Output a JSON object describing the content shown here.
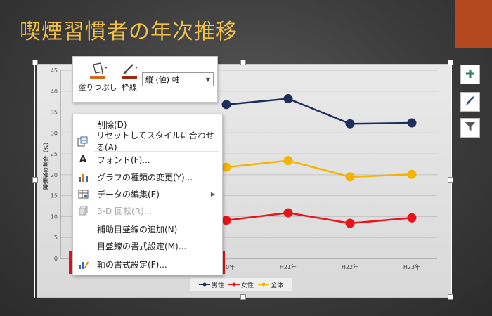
{
  "slide": {
    "title": "喫煙習慣者の年次推移"
  },
  "mini_toolbar": {
    "fill_label": "塗りつぶし",
    "outline_label": "枠線",
    "element_select_value": "縦 (値) 軸"
  },
  "context_menu": {
    "items": [
      {
        "label": "削除(D)",
        "icon": "delete-icon",
        "enabled": true
      },
      {
        "label": "リセットしてスタイルに合わせる(A)",
        "icon": "reset-style-icon",
        "enabled": true
      },
      {
        "label": "フォント(F)...",
        "icon": "font-icon",
        "enabled": true
      },
      {
        "label": "グラフの種類の変更(Y)...",
        "icon": "chart-type-icon",
        "enabled": true
      },
      {
        "label": "データの編集(E)",
        "icon": "edit-data-icon",
        "enabled": true
      },
      {
        "label": "3-D 回転(R)...",
        "icon": "rotate-3d-icon",
        "enabled": false
      },
      {
        "label": "補助目盛線の追加(N)",
        "icon": "",
        "enabled": true
      },
      {
        "label": "目盛線の書式設定(M)...",
        "icon": "",
        "enabled": true
      },
      {
        "label": "軸の書式設定(F)...",
        "icon": "format-axis-icon",
        "enabled": true
      }
    ]
  },
  "chart_data": {
    "type": "line",
    "title": "",
    "ylabel": "喫煙者の割合（%）",
    "ylim": [
      0,
      45
    ],
    "yticks": [
      "0",
      "5",
      "10",
      "15",
      "20",
      "25",
      "30",
      "35",
      "40",
      "45"
    ],
    "categories": [
      "H20年",
      "H21年",
      "H22年",
      "H23年"
    ],
    "series": [
      {
        "name": "男性",
        "color": "#1f2d5c",
        "values": [
          36.8,
          38.2,
          32.2,
          32.4
        ]
      },
      {
        "name": "女性",
        "color": "#e8141c",
        "values": [
          9.1,
          10.9,
          8.4,
          9.7
        ]
      },
      {
        "name": "全体",
        "color": "#f5b400",
        "values": [
          21.8,
          23.4,
          19.5,
          20.1
        ]
      }
    ]
  },
  "colors": {
    "title": "#f2c14a",
    "accent_bar": "#b3471d",
    "highlight_border": "#e0141c"
  }
}
